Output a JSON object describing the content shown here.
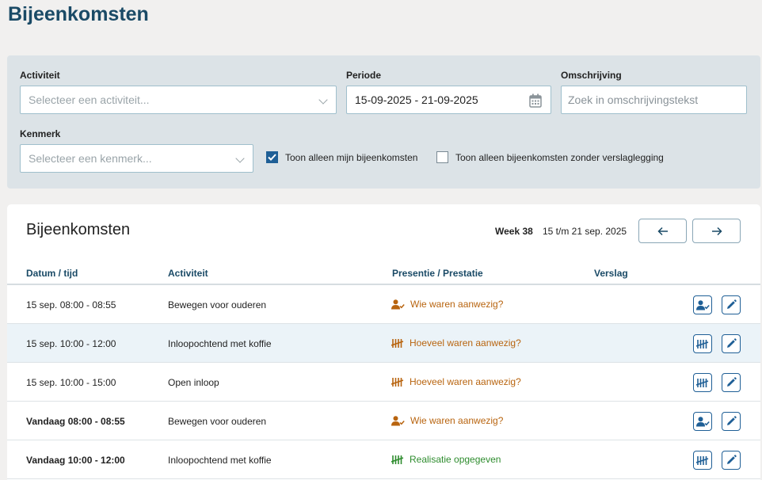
{
  "page": {
    "title": "Bijeenkomsten"
  },
  "filters": {
    "activiteit": {
      "label": "Activiteit",
      "placeholder": "Selecteer een activiteit..."
    },
    "periode": {
      "label": "Periode",
      "value": "15-09-2025 - 21-09-2025"
    },
    "omschrijving": {
      "label": "Omschrijving",
      "placeholder": "Zoek in omschrijvingstekst"
    },
    "kenmerk": {
      "label": "Kenmerk",
      "placeholder": "Selecteer een kenmerk..."
    },
    "check_mine": {
      "label": "Toon alleen mijn bijeenkomsten",
      "checked": true
    },
    "check_no_report": {
      "label": "Toon alleen bijeenkomsten zonder verslaglegging",
      "checked": false
    }
  },
  "list": {
    "title": "Bijeenkomsten",
    "week_label": "Week 38",
    "week_range": "15 t/m 21 sep. 2025",
    "columns": [
      "Datum / tijd",
      "Activiteit",
      "Presentie / Prestatie",
      "Verslag"
    ],
    "rows": [
      {
        "datetime": "15 sep. 08:00 - 08:55",
        "activity": "Bewegen voor ouderen",
        "presence": "Wie waren aanwezig?",
        "presence_icon": "person-check-icon",
        "status_color": "#b8640f",
        "action_icon": "person-check-icon",
        "bold": false,
        "highlight": false
      },
      {
        "datetime": "15 sep. 10:00 - 12:00",
        "activity": "Inloopochtend met koffie",
        "presence": "Hoeveel waren aanwezig?",
        "presence_icon": "tally-icon",
        "status_color": "#b8640f",
        "action_icon": "tally-icon",
        "bold": false,
        "highlight": true
      },
      {
        "datetime": "15 sep. 10:00 - 15:00",
        "activity": "Open inloop",
        "presence": "Hoeveel waren aanwezig?",
        "presence_icon": "tally-icon",
        "status_color": "#b8640f",
        "action_icon": "tally-icon",
        "bold": false,
        "highlight": false
      },
      {
        "datetime": "Vandaag 08:00 - 08:55",
        "activity": "Bewegen voor ouderen",
        "presence": "Wie waren aanwezig?",
        "presence_icon": "person-check-icon",
        "status_color": "#b8640f",
        "action_icon": "person-check-icon",
        "bold": true,
        "highlight": false
      },
      {
        "datetime": "Vandaag 10:00 - 12:00",
        "activity": "Inloopochtend met koffie",
        "presence": "Realisatie opgegeven",
        "presence_icon": "tally-icon",
        "status_color": "#2e8c2e",
        "action_icon": "tally-icon",
        "bold": true,
        "highlight": false
      }
    ]
  },
  "colors": {
    "accent": "#1a4a66",
    "button_blue": "#1f5f96",
    "orange": "#b8640f",
    "green": "#2e8c2e"
  }
}
